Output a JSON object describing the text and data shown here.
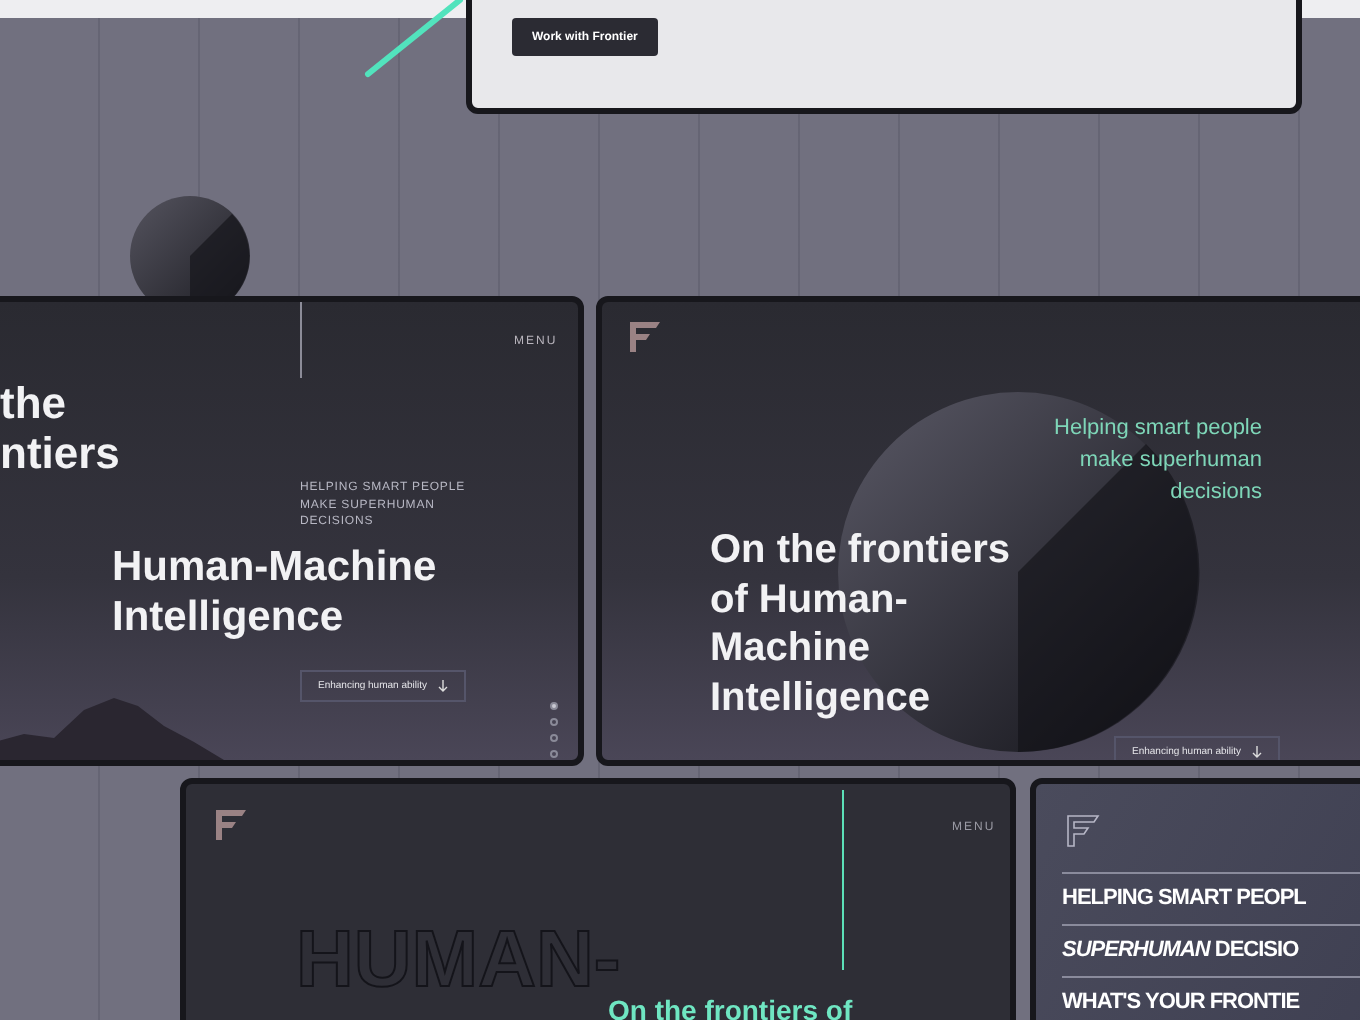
{
  "top_card": {
    "button": "Work with Frontier"
  },
  "card_a": {
    "title_cut": [
      "the",
      "ntiers"
    ],
    "menu": "MENU",
    "tagline": [
      "HELPING SMART PEOPLE",
      "MAKE SUPERHUMAN",
      "DECISIONS"
    ],
    "heading": [
      "Human-Machine",
      "Intelligence"
    ],
    "button": "Enhancing human ability",
    "dots": [
      {
        "selected": true
      },
      {
        "selected": false
      },
      {
        "selected": false
      },
      {
        "selected": false
      }
    ]
  },
  "card_b": {
    "tagline": [
      "Helping smart people",
      "make superhuman",
      "decisions"
    ],
    "heading": [
      "On the frontiers",
      "of Human-",
      "Machine",
      "Intelligence"
    ],
    "button": "Enhancing human ability"
  },
  "card_c": {
    "menu": "MENU",
    "outline_word": "HUMAN-",
    "subheading": "On the frontiers of"
  },
  "card_d": {
    "rows": [
      "HELPING SMART PEOPL",
      "*SUPERHUMAN* DECISIO",
      "WHAT'S YOUR FRONTIE"
    ]
  }
}
